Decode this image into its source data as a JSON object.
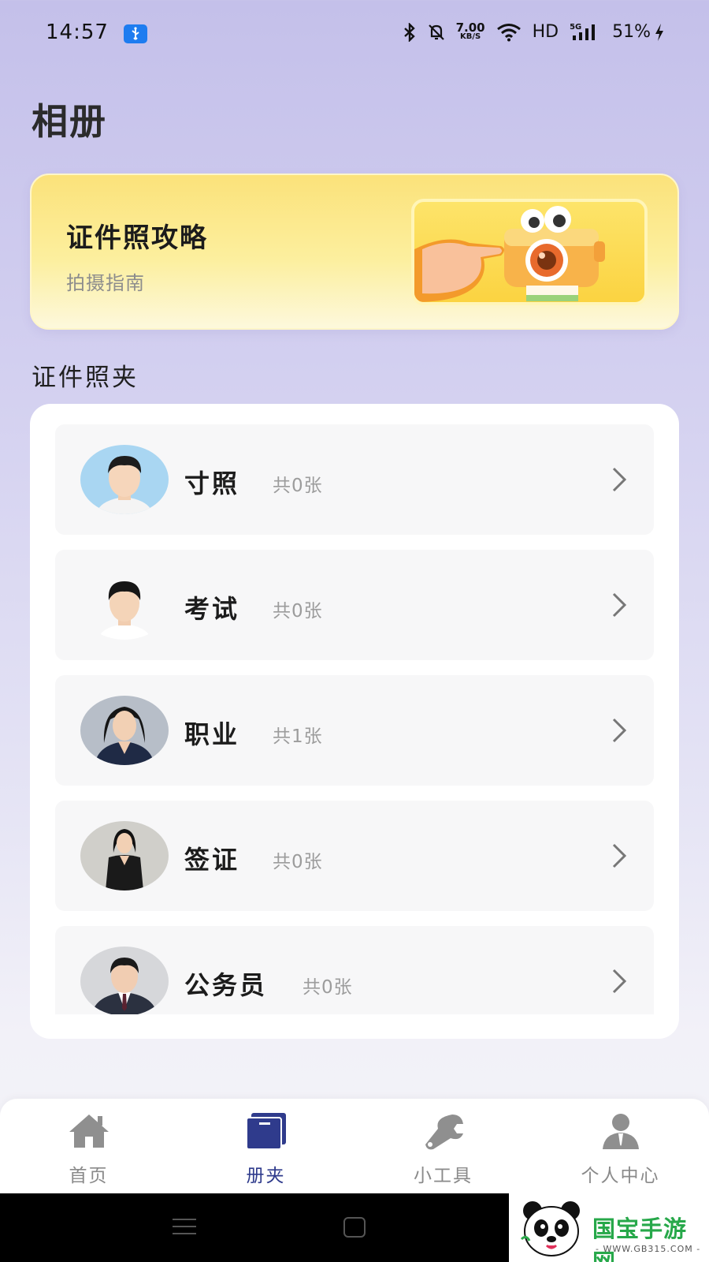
{
  "status_bar": {
    "time": "14:57",
    "net_speed": "7.00",
    "net_speed_unit": "KB/S",
    "hd_label": "HD",
    "network_type": "5G",
    "battery_percent": "51%"
  },
  "page_title": "相册",
  "guide_banner": {
    "title": "证件照攻略",
    "subtitle": "拍摄指南"
  },
  "section_title": "证件照夹",
  "folders": [
    {
      "name": "寸照",
      "count": "共0张"
    },
    {
      "name": "考试",
      "count": "共0张"
    },
    {
      "name": "职业",
      "count": "共1张"
    },
    {
      "name": "签证",
      "count": "共0张"
    },
    {
      "name": "公务员",
      "count": "共0张"
    }
  ],
  "bottom_nav": [
    {
      "label": "首页",
      "icon": "home-icon",
      "active": false
    },
    {
      "label": "册夹",
      "icon": "album-icon",
      "active": true
    },
    {
      "label": "小工具",
      "icon": "wrench-icon",
      "active": false
    },
    {
      "label": "个人中心",
      "icon": "person-icon",
      "active": false
    }
  ],
  "watermark": {
    "text": "国宝手游网",
    "url": "- WWW.GB315.COM -"
  },
  "colors": {
    "accent": "#2f3b8c",
    "banner_yellow": "#fbe27a",
    "background_top": "#c4c0ea"
  }
}
